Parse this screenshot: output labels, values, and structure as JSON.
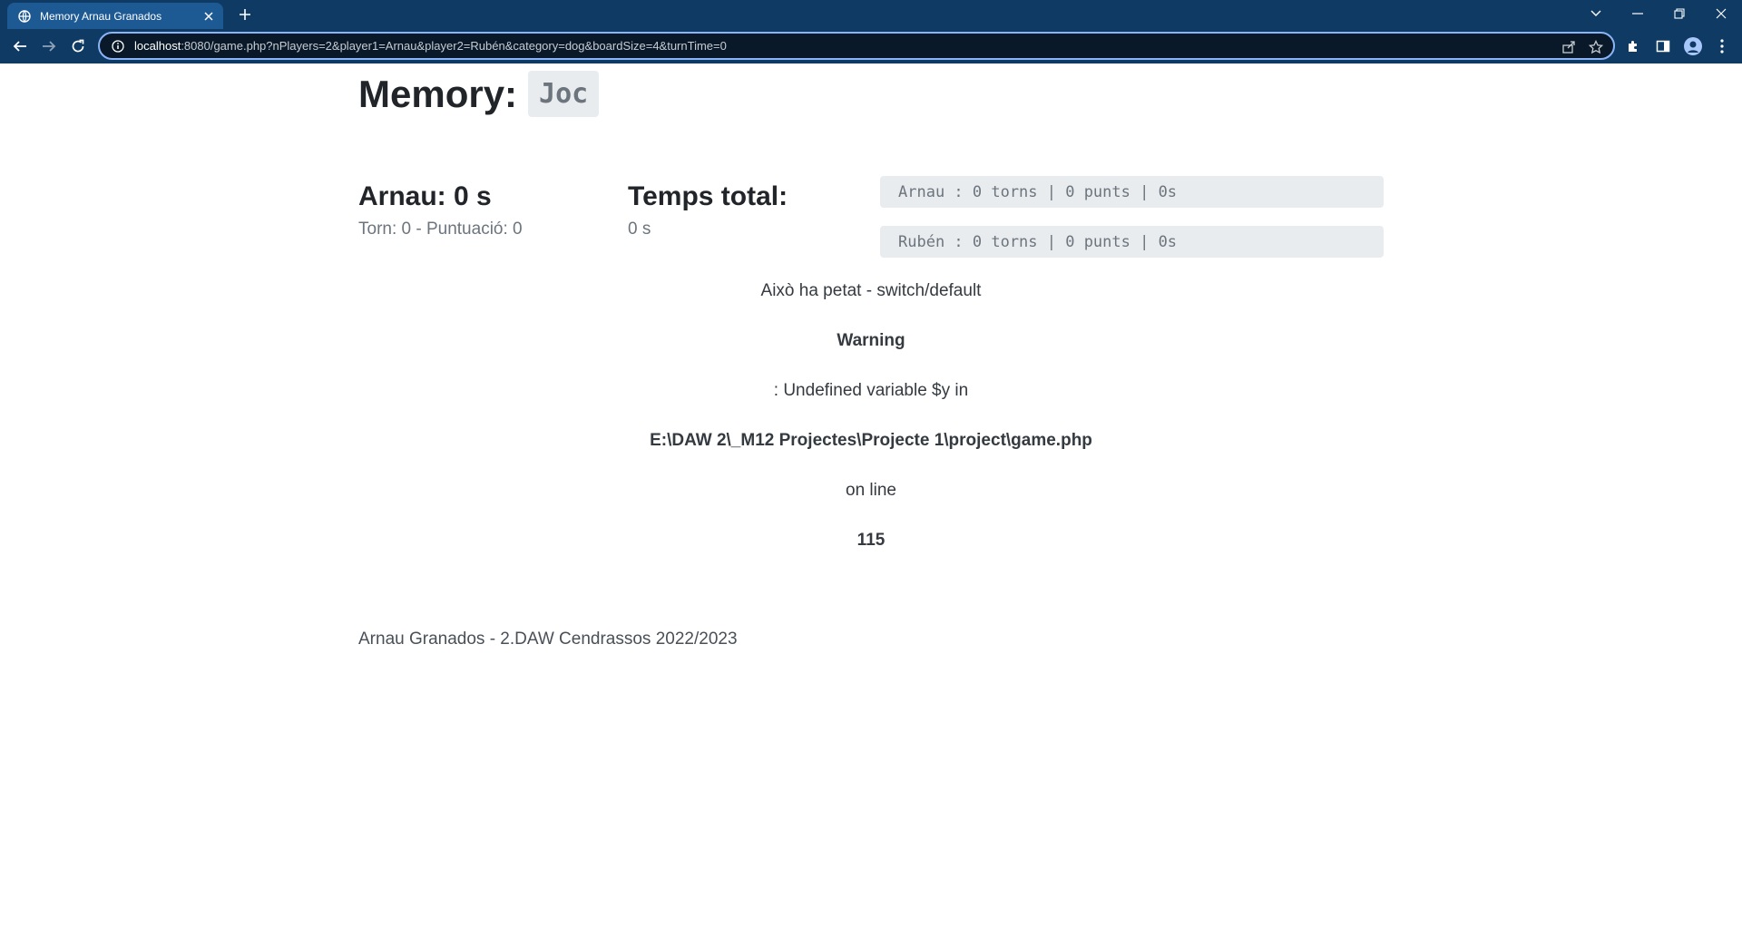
{
  "browser": {
    "tab_title": "Memory Arnau Granados",
    "url_host": "localhost",
    "url_rest": ":8080/game.php?nPlayers=2&player1=Arnau&player2=Rubén&category=dog&boardSize=4&turnTime=0"
  },
  "page": {
    "title": "Memory:",
    "badge": "Joc",
    "player_heading": "Arnau: 0 s",
    "player_sub": "Torn: 0 - Puntuació: 0",
    "total_heading": "Temps total:",
    "total_value": "0 s",
    "scores": [
      "Arnau : 0 torns | 0 punts | 0s",
      "Rubén : 0 torns | 0 punts | 0s"
    ],
    "error": {
      "message": "Això ha petat - switch/default",
      "warning": "Warning",
      "detail": ": Undefined variable $y in",
      "file": "E:\\DAW 2\\_M12 Projectes\\Projecte 1\\project\\game.php",
      "on_line": "on line",
      "line": "115"
    },
    "footer": "Arnau Granados - 2.DAW Cendrassos 2022/2023"
  },
  "icons": {
    "favicon": "globe-icon",
    "tab_close": "close-icon",
    "new_tab": "plus-icon",
    "back": "back-arrow-icon",
    "forward": "forward-arrow-icon",
    "reload": "reload-icon",
    "site_info": "info-icon",
    "share": "share-icon",
    "bookmark": "star-icon",
    "extensions": "puzzle-icon",
    "side_panel": "side-panel-icon",
    "profile": "avatar",
    "menu": "kebab-menu-icon"
  },
  "colors": {
    "chrome_bg": "#0e3a64",
    "active_tab": "#1d5a94",
    "omnibox_border": "#8ab4f8"
  }
}
